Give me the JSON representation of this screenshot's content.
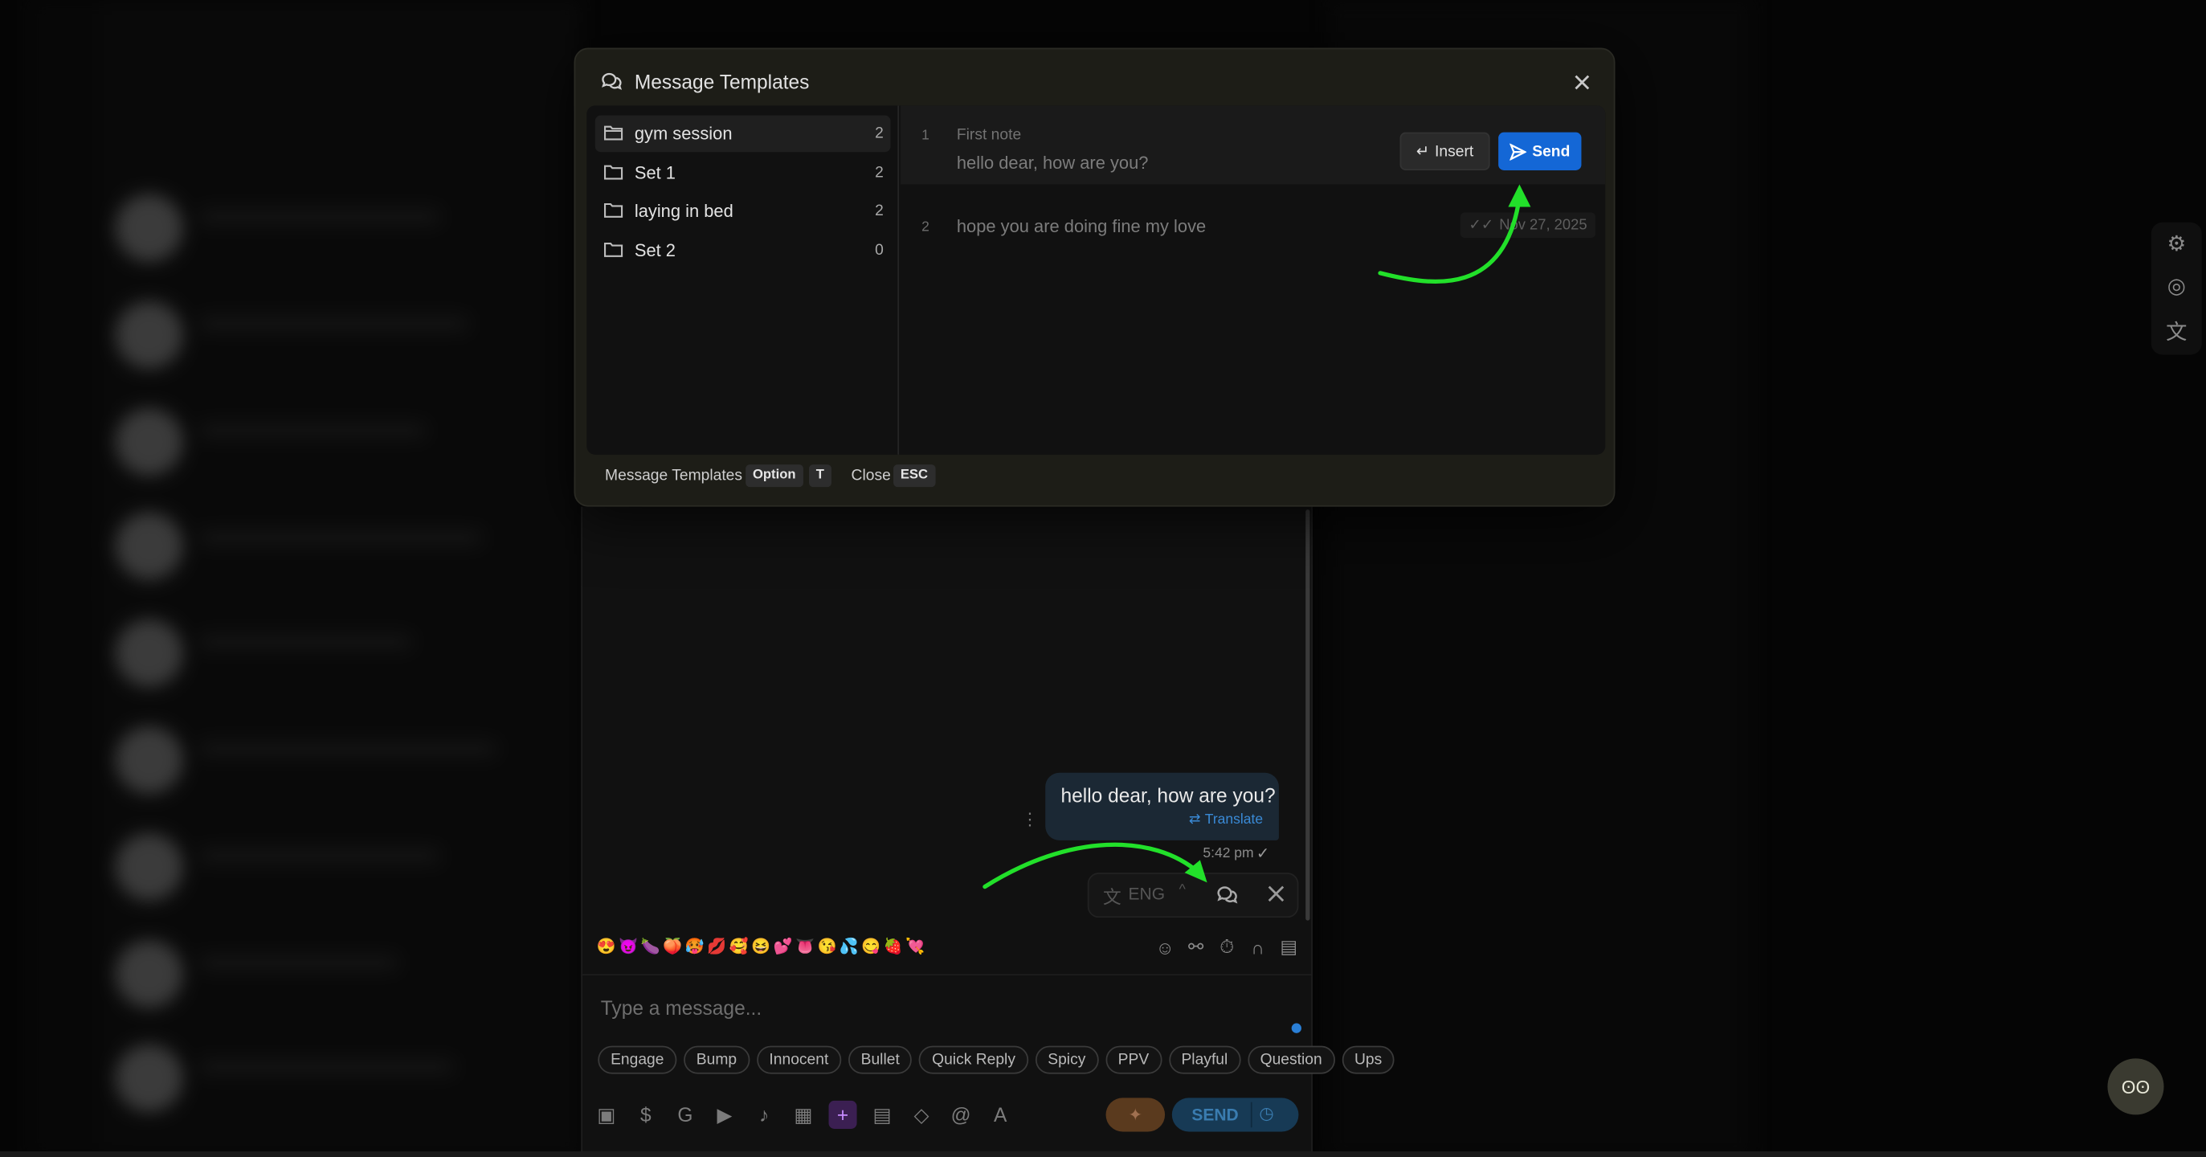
{
  "modal": {
    "title": "Message Templates",
    "folders": [
      {
        "name": "gym session",
        "count": "2",
        "active": true
      },
      {
        "name": "Set 1",
        "count": "2"
      },
      {
        "name": "laying in bed",
        "count": "2"
      },
      {
        "name": "Set 2",
        "count": "0"
      }
    ],
    "templates": [
      {
        "index": "1",
        "label": "First note",
        "text": "hello dear, how are you?"
      },
      {
        "index": "2",
        "text": "hope you are doing fine my love",
        "date": "Nov 27, 2025"
      }
    ],
    "insert_label": "Insert",
    "send_label": "Send",
    "footer": {
      "templates_label": "Message Templates",
      "templates_key1": "Option",
      "templates_key2": "T",
      "close_label": "Close",
      "close_key": "ESC"
    }
  },
  "chat": {
    "message_text": "hello dear, how are you?",
    "translate_label": "Translate",
    "time": "5:42 pm",
    "language": "ENG",
    "input_placeholder": "Type a message...",
    "emojis": "😍😈🍆🍑🥵💋🥰😆💕👅😘💦😋🍓💘",
    "chips": [
      "Engage",
      "Bump",
      "Innocent",
      "Bullet",
      "Quick Reply",
      "Spicy",
      "PPV",
      "Playful",
      "Question",
      "Ups"
    ],
    "send_label": "SEND"
  },
  "colors": {
    "accent_blue": "#1467d6",
    "arrow_green": "#22e02a"
  }
}
